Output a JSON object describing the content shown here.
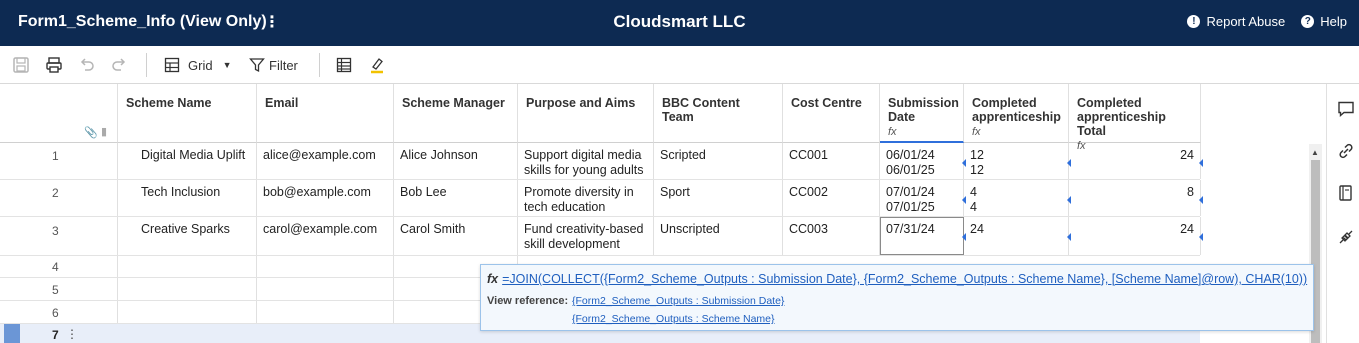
{
  "header": {
    "sheet_title": "Form1_Scheme_Info (View Only)",
    "menu_glyph": "⋮",
    "company": "Cloudsmart LLC",
    "report_abuse": "Report Abuse",
    "help": "Help"
  },
  "toolbar": {
    "grid_label": "Grid",
    "filter_label": "Filter"
  },
  "columns": [
    {
      "label": "Scheme Name",
      "formula": false
    },
    {
      "label": "Email",
      "formula": false
    },
    {
      "label": "Scheme Manager",
      "formula": false
    },
    {
      "label": "Purpose and Aims",
      "formula": false
    },
    {
      "label": "BBC Content Team",
      "formula": false
    },
    {
      "label": "Cost Centre",
      "formula": false
    },
    {
      "label": "Submission Date",
      "formula": true
    },
    {
      "label": "Completed apprenticeship",
      "formula": true
    },
    {
      "label": "Completed apprenticeship Total",
      "formula": true
    }
  ],
  "formula_glyph": "fx",
  "rows": [
    {
      "num": "1",
      "scheme_name": "Digital Media Uplift",
      "email": "alice@example.com",
      "manager": "Alice Johnson",
      "purpose": "Support digital media skills for young adults",
      "team": "Scripted",
      "cost_centre": "CC001",
      "submission_date_1": "06/01/24",
      "submission_date_2": "06/01/25",
      "completed_1": "12",
      "completed_2": "12",
      "total": "24"
    },
    {
      "num": "2",
      "scheme_name": "Tech Inclusion",
      "email": "bob@example.com",
      "manager": "Bob Lee",
      "purpose": "Promote diversity in tech education",
      "team": "Sport",
      "cost_centre": "CC002",
      "submission_date_1": "07/01/24",
      "submission_date_2": "07/01/25",
      "completed_1": "4",
      "completed_2": "4",
      "total": "8"
    },
    {
      "num": "3",
      "scheme_name": "Creative Sparks",
      "email": "carol@example.com",
      "manager": "Carol Smith",
      "purpose": "Fund creativity-based skill development",
      "team": "Unscripted",
      "cost_centre": "CC003",
      "submission_date_1": "07/31/24",
      "submission_date_2": "",
      "completed_1": "24",
      "completed_2": "",
      "total": "24"
    }
  ],
  "empty_rows": [
    "4",
    "5",
    "6"
  ],
  "active_row": "7",
  "popup": {
    "formula": "=JOIN(COLLECT({Form2_Scheme_Outputs : Submission Date}, {Form2_Scheme_Outputs : Scheme Name}, [Scheme Name]@row), CHAR(10))",
    "view_reference_label": "View reference:",
    "refs": [
      "{Form2_Scheme_Outputs : Submission Date}",
      "{Form2_Scheme_Outputs : Scheme Name}"
    ]
  },
  "colors": {
    "topbar": "#0d2a52",
    "link": "#1f5fbf",
    "marker": "#2f6fdb"
  }
}
